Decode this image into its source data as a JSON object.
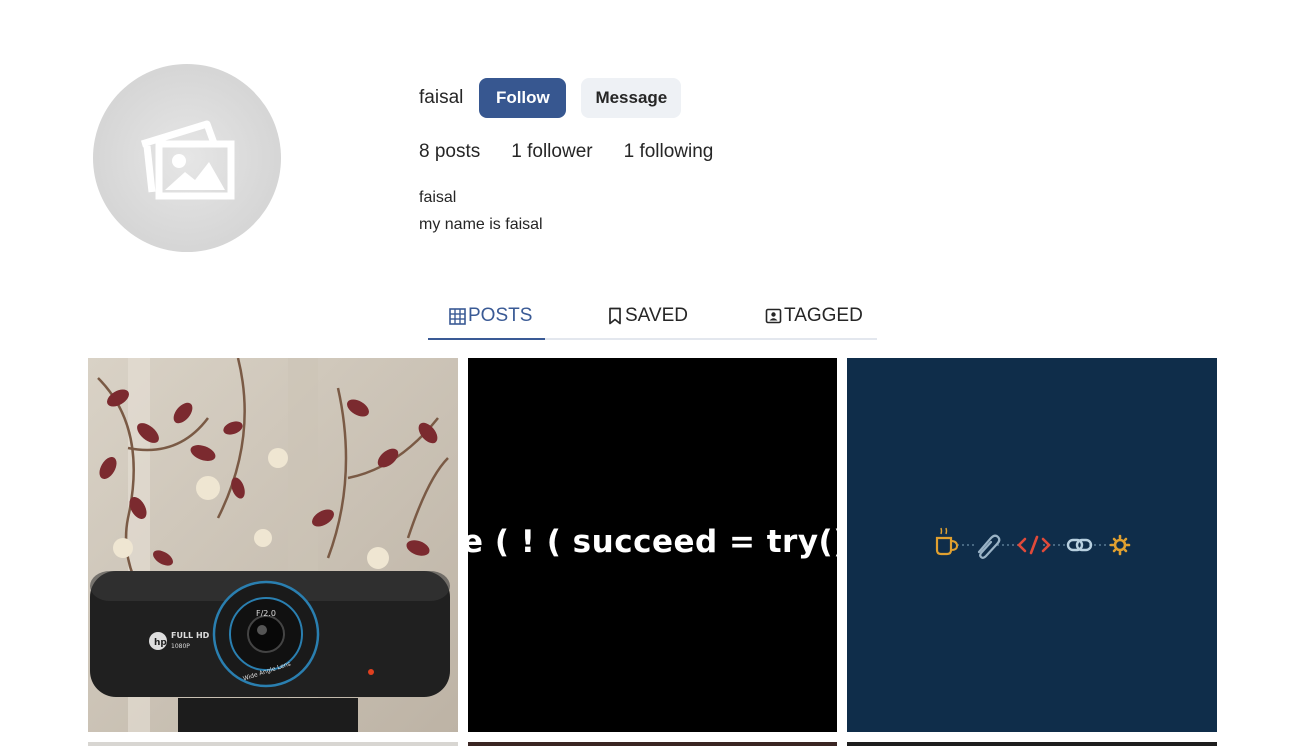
{
  "profile": {
    "username": "faisal",
    "follow_label": "Follow",
    "message_label": "Message",
    "posts": "8 posts",
    "followers": "1 follower",
    "following": "1 following",
    "display_name": "faisal",
    "bio": "my name is faisal"
  },
  "tabs": {
    "posts": "POSTS",
    "saved": "SAVED",
    "tagged": "TAGGED",
    "active": "posts"
  },
  "colors": {
    "accent": "#375790",
    "active_tab": "#3a5a95",
    "message_bg": "#eef1f5",
    "tile_navy": "#0f2d4a"
  },
  "posts_grid": {
    "tile_2_text": "e ( ! ( succeed = try()",
    "tile_1_camera_text": [
      "FULL HD",
      "1080P",
      "F/2.0",
      "Wide Angle Lens"
    ],
    "tile_3_icons": [
      "coffee-icon",
      "paperclip-icon",
      "code-icon",
      "link-icon",
      "gear-icon"
    ]
  }
}
